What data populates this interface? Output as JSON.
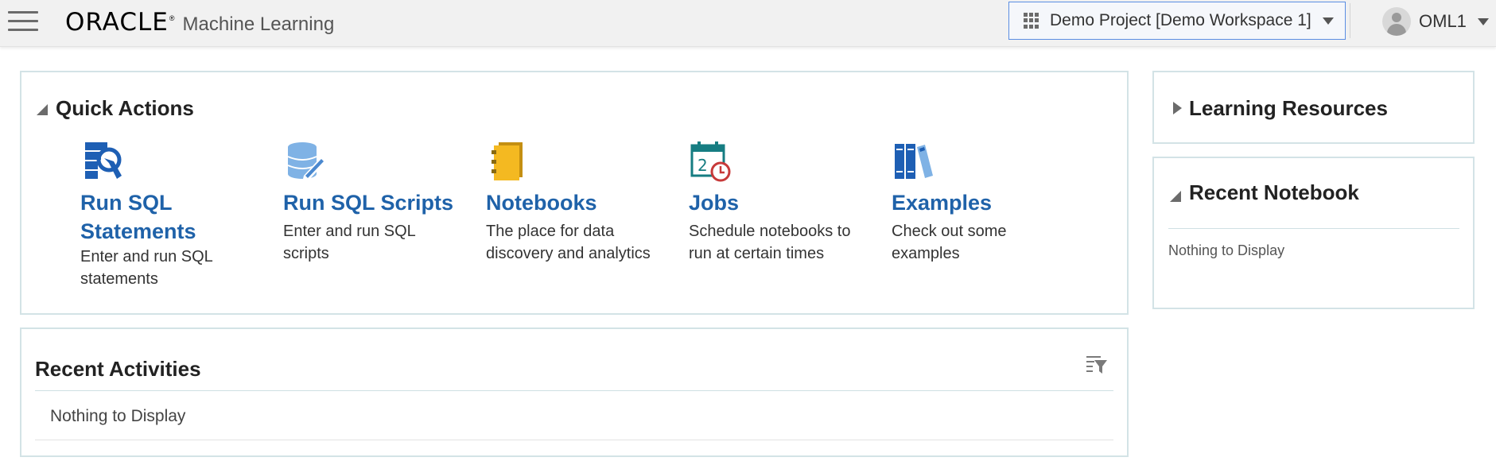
{
  "header": {
    "brand_logo": "ORACLE",
    "brand_registered": "®",
    "brand_product": "Machine Learning",
    "project_selector_label": "Demo Project [Demo Workspace 1]",
    "user_name": "OML1"
  },
  "quick_actions": {
    "title": "Quick Actions",
    "items": [
      {
        "title_line1": "Run SQL",
        "title_line2": "Statements",
        "desc_line1": "Enter and run SQL",
        "desc_line2": "statements",
        "icon": "sql-statements-icon"
      },
      {
        "title": "Run SQL Scripts",
        "desc_line1": "Enter and run SQL",
        "desc_line2": "scripts",
        "icon": "sql-scripts-icon"
      },
      {
        "title": "Notebooks",
        "desc_line1": "The place for data",
        "desc_line2": "discovery and analytics",
        "icon": "notebook-icon"
      },
      {
        "title": "Jobs",
        "desc_line1": "Schedule notebooks to",
        "desc_line2": "run at certain times",
        "icon": "jobs-calendar-icon"
      },
      {
        "title": "Examples",
        "desc_line1": "Check out some",
        "desc_line2": "examples",
        "icon": "examples-books-icon"
      }
    ]
  },
  "recent_activities": {
    "title": "Recent Activities",
    "empty_text": "Nothing to Display",
    "filter_icon": "filter-icon"
  },
  "learning_resources": {
    "title": "Learning Resources"
  },
  "recent_notebook": {
    "title": "Recent Notebook",
    "empty_text": "Nothing to Display"
  },
  "colors": {
    "link_blue": "#1f62a9",
    "panel_border": "#d3e3e6",
    "selector_border": "#5b8ee3",
    "icon_blue": "#1e5fb4",
    "icon_light_blue": "#7fb2e5",
    "notebook_gold": "#f4b921",
    "jobs_teal": "#167d82",
    "jobs_red": "#c73a3a"
  }
}
